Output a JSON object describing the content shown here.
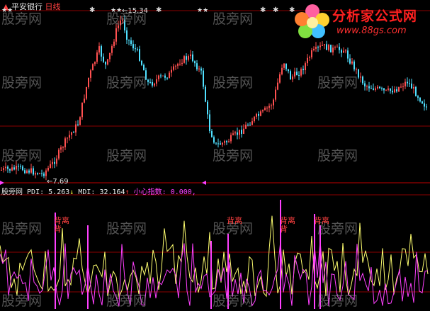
{
  "header": {
    "badge": "▲",
    "stock_name": "平安银行",
    "period": "日线"
  },
  "annotations": {
    "high_label": "15.34",
    "low_label": "7.69",
    "stars": "★★",
    "star_single": "✱"
  },
  "indicator": {
    "source": "股旁网",
    "pdi_label": "PDI:",
    "pdi_value": "5.263",
    "pdi_arrow": "↓",
    "mdi_label": "MDI:",
    "mdi_value": "32.164",
    "mdi_arrow": "↑",
    "xx_label": "小心指数:",
    "xx_value": "0.000,"
  },
  "signals": [
    {
      "text": "背离\n背"
    },
    {
      "text": "背离"
    },
    {
      "text": "背离\n背"
    },
    {
      "text": "背离"
    }
  ],
  "watermark": "股旁网",
  "logo": {
    "brand": "分析家公式网",
    "url": "www.88gs.com"
  },
  "colors": {
    "up": "#ff5050",
    "down": "#50e0ff",
    "pdi": "#ffff70",
    "mdi": "#ff40ff",
    "grid": "#8b0000"
  }
}
